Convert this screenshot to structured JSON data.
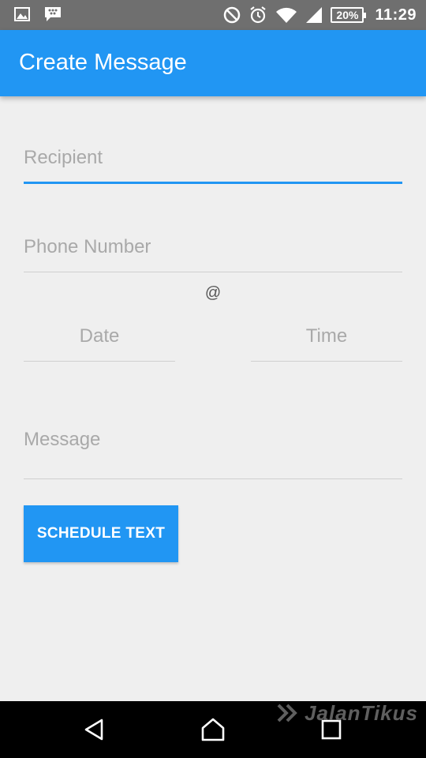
{
  "status_bar": {
    "left_icons": [
      "gallery-icon",
      "bbm-chat-icon"
    ],
    "right_icons": [
      "do-not-disturb-icon",
      "alarm-icon",
      "wifi-icon",
      "signal-icon"
    ],
    "battery": "20%",
    "time": "11:29"
  },
  "app_bar": {
    "title": "Create Message",
    "color": "#2196f3"
  },
  "form": {
    "recipient_placeholder": "Recipient",
    "recipient_value": "",
    "phone_placeholder": "Phone Number",
    "phone_value": "",
    "at_separator": "@",
    "date_placeholder": "Date",
    "date_value": "",
    "time_placeholder": "Time",
    "time_value": "",
    "message_placeholder": "Message",
    "message_value": "",
    "schedule_button_label": "SCHEDULE TEXT"
  },
  "nav_bar": {
    "buttons": [
      "back-icon",
      "home-icon",
      "recent-apps-icon"
    ]
  },
  "watermark": {
    "text": "JalanTikus"
  }
}
